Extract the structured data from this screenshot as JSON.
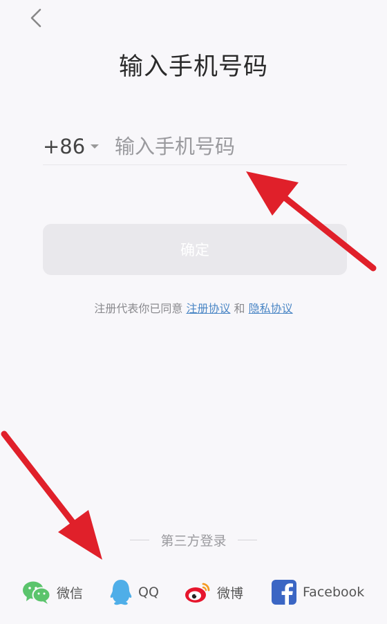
{
  "header": {
    "title": "输入手机号码"
  },
  "phone": {
    "country_code": "+86",
    "placeholder": "输入手机号码",
    "value": ""
  },
  "confirm_button": {
    "label": "确定"
  },
  "agreement": {
    "prefix": "注册代表你已同意 ",
    "terms_link": "注册协议",
    "joiner": " 和 ",
    "privacy_link": "隐私协议"
  },
  "third_party": {
    "heading": "第三方登录",
    "options": [
      {
        "label": "微信",
        "icon": "wechat-icon",
        "color": "#5bc46c"
      },
      {
        "label": "QQ",
        "icon": "qq-icon",
        "color": "#4faee8"
      },
      {
        "label": "微博",
        "icon": "weibo-icon",
        "color": "#e6162d"
      },
      {
        "label": "Facebook",
        "icon": "facebook-icon",
        "color": "#3b66c4"
      }
    ]
  },
  "colors": {
    "background": "#f8f7fa",
    "link": "#4a86c5",
    "annotation_arrow": "#e0202a"
  }
}
